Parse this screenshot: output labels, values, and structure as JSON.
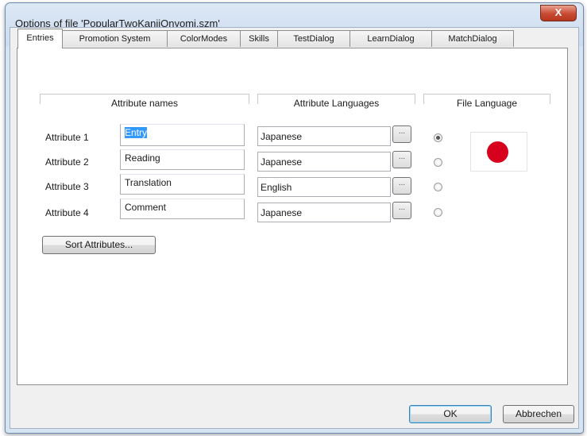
{
  "window": {
    "title": "Options of file 'PopularTwoKanjiOnyomi.szm'",
    "close_label": "X"
  },
  "tabs": [
    {
      "label": "Entries",
      "active": true
    },
    {
      "label": "Promotion System",
      "active": false
    },
    {
      "label": "ColorModes",
      "active": false
    },
    {
      "label": "Skills",
      "active": false
    },
    {
      "label": "TestDialog",
      "active": false
    },
    {
      "label": "LearnDialog",
      "active": false
    },
    {
      "label": "MatchDialog",
      "active": false
    }
  ],
  "headers": {
    "attribute_names": "Attribute names",
    "attribute_languages": "Attribute Languages",
    "file_language": "File Language"
  },
  "attributes": [
    {
      "label": "Attribute 1",
      "name": "Entry",
      "language": "Japanese",
      "button": "...",
      "file_language_selected": true
    },
    {
      "label": "Attribute 2",
      "name": "Reading",
      "language": "Japanese",
      "button": "...",
      "file_language_selected": false
    },
    {
      "label": "Attribute 3",
      "name": "Translation",
      "language": "English",
      "button": "...",
      "file_language_selected": false
    },
    {
      "label": "Attribute 4",
      "name": "Comment",
      "language": "Japanese",
      "button": "...",
      "file_language_selected": false
    }
  ],
  "file_language_flag": {
    "icon": "japan-flag-icon",
    "disc_color": "#d7001d"
  },
  "sort_button": "Sort Attributes...",
  "footer": {
    "ok": "OK",
    "cancel": "Abbrechen"
  }
}
